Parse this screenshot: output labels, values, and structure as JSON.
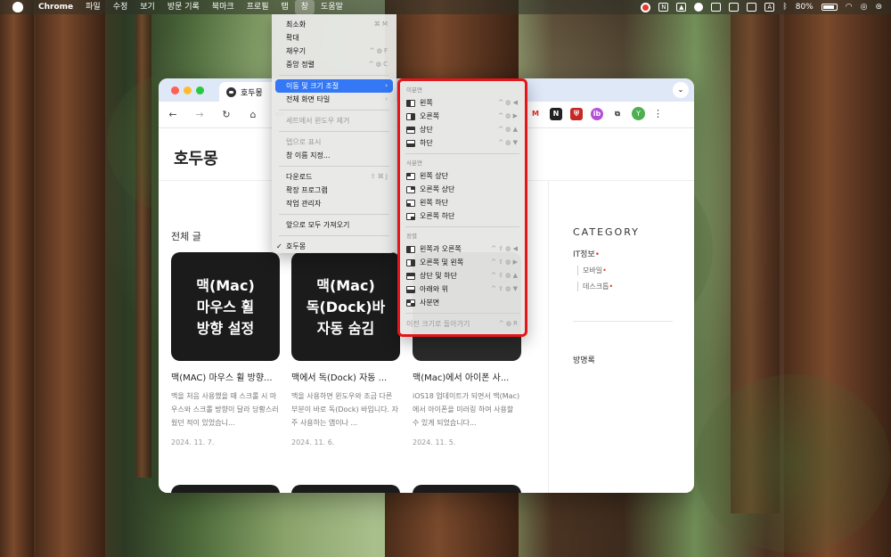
{
  "menubar": {
    "app_name": "Chrome",
    "items": [
      "파일",
      "수정",
      "보기",
      "방문 기록",
      "북마크",
      "프로필",
      "탭",
      "창",
      "도움말"
    ],
    "active_item": "창",
    "battery": "80%",
    "input_indicator": "A"
  },
  "browser": {
    "tab_title": "호두몽",
    "tab_chevron": "⌄",
    "nav": {
      "back": "←",
      "forward": "→",
      "reload": "↻",
      "home": "⌂",
      "site_info": "⚯"
    },
    "extensions": [
      "M",
      "N",
      "⛨",
      "ib",
      "⧉"
    ],
    "profile_initial": "Y",
    "menu_icon": "⋮"
  },
  "page": {
    "site_title": "호두몽",
    "section_label": "전체 글",
    "posts": [
      {
        "thumb_text": "맥(Mac)\n마우스 휠\n방향 설정",
        "title": "맥(MAC) 마우스 휠 방향...",
        "excerpt": "맥을 처음 사용했을 때 스크롤 시 마우스와 스크롤 방향이 달라 당황스러웠던 적이 있었습니...",
        "date": "2024. 11. 7."
      },
      {
        "thumb_text": "맥(Mac)\n독(Dock)바\n자동 숨김",
        "title": "맥에서 독(Dock) 자동 ...",
        "excerpt": "맥을 사용하면 윈도우와 조금 다른 부분이 바로 독(Dock) 바입니다. 자주 사용하는 앱이나 ...",
        "date": "2024. 11. 6."
      },
      {
        "thumb_text": "",
        "title": "맥(Mac)에서 아이폰 사...",
        "excerpt": "iOS18 업데이트가 되면서 맥(Mac)에서 아이폰을 미러링 하여 사용할 수 있게 되었습니다...",
        "date": "2024. 11. 5."
      }
    ],
    "sidebar": {
      "category_heading": "CATEGORY",
      "category_main": "IT정보",
      "subcategories": [
        "모바일",
        "데스크톱"
      ],
      "star": "•",
      "guestbook": "방명록"
    }
  },
  "window_menu": {
    "items": [
      {
        "label": "최소화",
        "shortcut": "⌘ M",
        "disabled": false
      },
      {
        "label": "확대",
        "shortcut": "",
        "disabled": false
      },
      {
        "label": "채우기",
        "shortcut": "^ ◍ F",
        "disabled": false
      },
      {
        "label": "중앙 정렬",
        "shortcut": "^ ◍ C",
        "disabled": false
      },
      {
        "label": "이동 및 크기 조절",
        "shortcut": "›",
        "selected": true
      },
      {
        "label": "전체 화면 타일",
        "shortcut": "›",
        "disabled": false
      },
      {
        "label": "세트에서 윈도우 제거",
        "shortcut": "",
        "disabled": true
      },
      {
        "label": "탭으로 표시",
        "shortcut": "",
        "disabled": true
      },
      {
        "label": "창 이름 지정...",
        "shortcut": "",
        "disabled": false
      },
      {
        "label": "다운로드",
        "shortcut": "⇧ ⌘ J",
        "disabled": false
      },
      {
        "label": "확장 프로그램",
        "shortcut": "",
        "disabled": false
      },
      {
        "label": "작업 관리자",
        "shortcut": "",
        "disabled": false
      },
      {
        "label": "앞으로 모두 가져오기",
        "shortcut": "",
        "disabled": false
      },
      {
        "label": "호두몽",
        "shortcut": "",
        "checked": true
      }
    ],
    "check_mark": "✓"
  },
  "submenu": {
    "sections": [
      {
        "heading": "이분면",
        "items": [
          {
            "label": "왼쪽",
            "shortcut": "^ ◍ ◀"
          },
          {
            "label": "오른쪽",
            "shortcut": "^ ◍ ▶"
          },
          {
            "label": "상단",
            "shortcut": "^ ◍ ▲"
          },
          {
            "label": "하단",
            "shortcut": "^ ◍ ▼"
          }
        ]
      },
      {
        "heading": "사분면",
        "items": [
          {
            "label": "왼쪽 상단",
            "shortcut": ""
          },
          {
            "label": "오른쪽 상단",
            "shortcut": ""
          },
          {
            "label": "왼쪽 하단",
            "shortcut": ""
          },
          {
            "label": "오른쪽 하단",
            "shortcut": ""
          }
        ]
      },
      {
        "heading": "정렬",
        "items": [
          {
            "label": "왼쪽과 오른쪽",
            "shortcut": "^ ⇧ ◍ ◀"
          },
          {
            "label": "오른쪽 및 왼쪽",
            "shortcut": "^ ⇧ ◍ ▶"
          },
          {
            "label": "상단 및 하단",
            "shortcut": "^ ⇧ ◍ ▲"
          },
          {
            "label": "아래와 위",
            "shortcut": "^ ⇧ ◍ ▼"
          },
          {
            "label": "사분면",
            "shortcut": ""
          }
        ]
      }
    ],
    "footer": {
      "label": "이전 크기로 돌아가기",
      "shortcut": "^ ◍ R"
    }
  },
  "colors": {
    "highlight_border": "#e4161b",
    "menu_selected": "#3478f6",
    "tab_bar": "#dfe8f7"
  }
}
